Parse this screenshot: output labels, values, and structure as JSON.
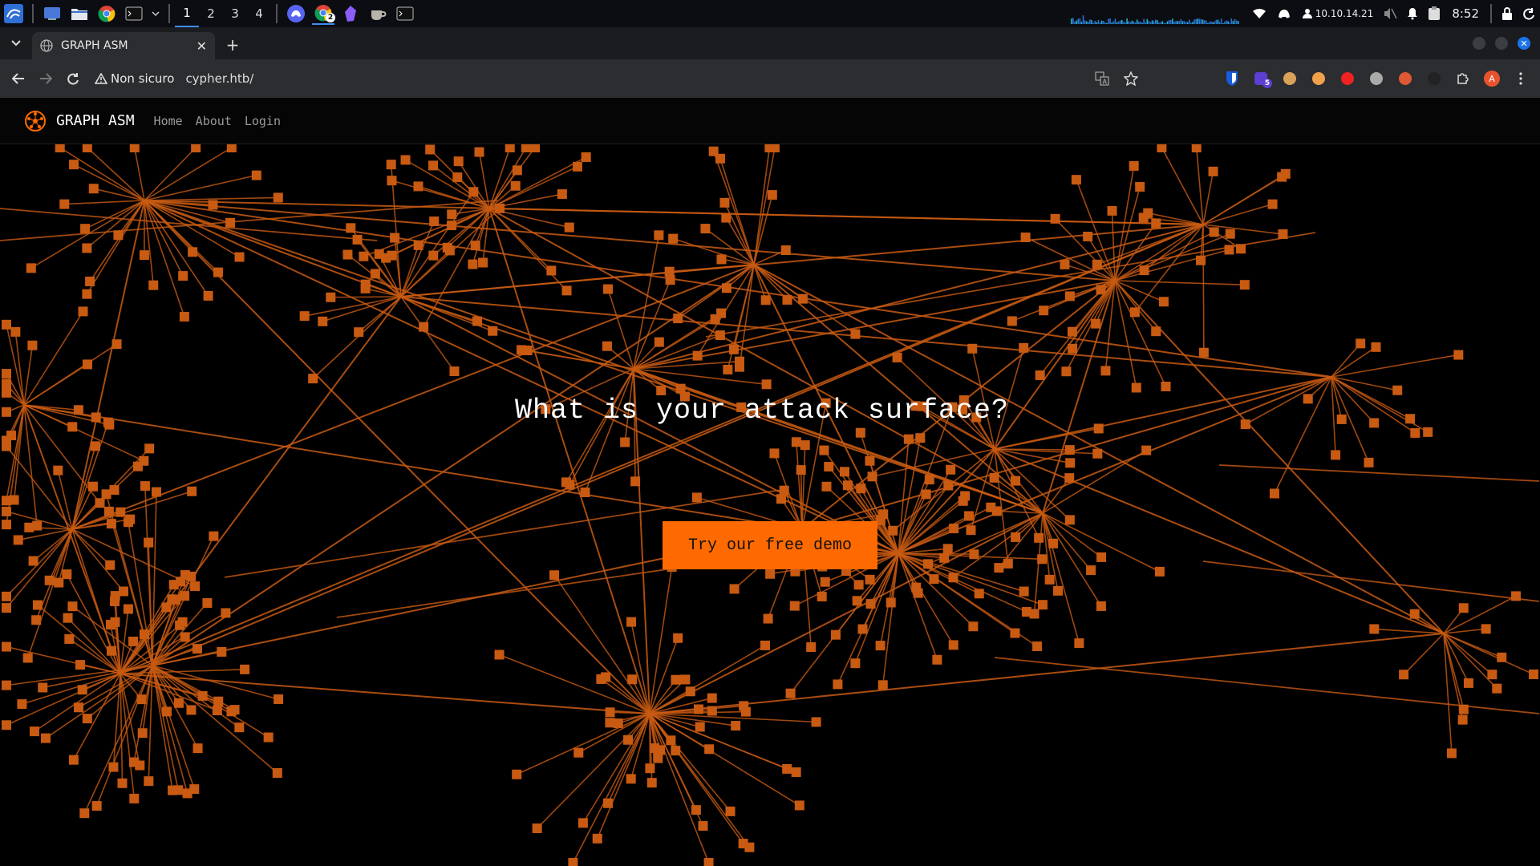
{
  "taskbar": {
    "workspaces": [
      "1",
      "2",
      "3",
      "4"
    ],
    "active_workspace": "1",
    "ip": "10.10.14.21",
    "time": "8:52",
    "chrome_badge": "2",
    "icons": [
      "kali-menu-icon",
      "desktop-icon",
      "files-icon",
      "chrome-icon",
      "terminal-icon",
      "discord-icon",
      "obsidian-icon",
      "coffee-icon"
    ]
  },
  "browser": {
    "tab_title": "GRAPH ASM",
    "security_label": "Non sicuro",
    "url": "cypher.htb/",
    "extension_badge": "5",
    "profile_initial": "A"
  },
  "site": {
    "brand": "GRAPH ASM",
    "nav": [
      "Home",
      "About",
      "Login"
    ],
    "hero_title": "What is your attack surface?",
    "cta_label": "Try our free demo"
  },
  "colors": {
    "accent": "#ff6a00",
    "graph": "#c85a12",
    "background": "#000000"
  }
}
